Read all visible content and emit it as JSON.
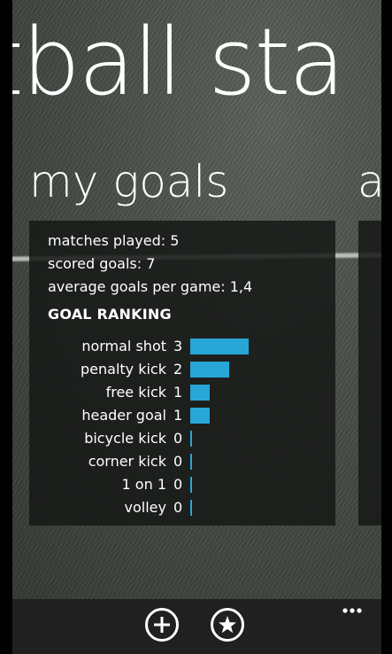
{
  "panorama": {
    "title": "tball sta",
    "current_section": "my goals",
    "next_section_peek": "a"
  },
  "stats": {
    "matches_played": "matches played: 5",
    "scored_goals": "scored goals: 7",
    "average": "average goals per game: 1,4"
  },
  "ranking": {
    "title": "GOAL RANKING",
    "bar_color": "#28a6d8",
    "max_value": 3,
    "rows": [
      {
        "label": "normal shot",
        "value": 3
      },
      {
        "label": "penalty kick",
        "value": 2
      },
      {
        "label": "free kick",
        "value": 1
      },
      {
        "label": "header goal",
        "value": 1
      },
      {
        "label": "bicycle kick",
        "value": 0
      },
      {
        "label": "corner kick",
        "value": 0
      },
      {
        "label": "1 on 1",
        "value": 0
      },
      {
        "label": "volley",
        "value": 0
      }
    ]
  },
  "app_bar": {
    "buttons": [
      {
        "icon": "add-icon"
      },
      {
        "icon": "star-icon"
      }
    ],
    "more_icon": "more-dots-icon"
  }
}
